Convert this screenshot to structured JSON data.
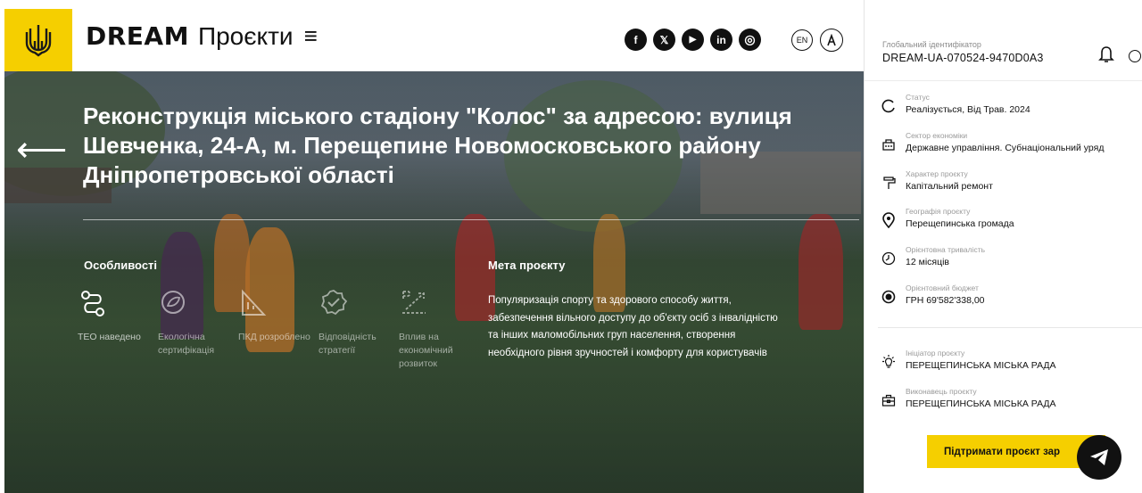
{
  "header": {
    "brand_bold": "DREAM",
    "brand_light": "Проєкти",
    "menu_glyph": "≡",
    "socials": [
      {
        "name": "facebook",
        "glyph": "f"
      },
      {
        "name": "x",
        "glyph": "𝕏"
      },
      {
        "name": "youtube",
        "glyph": "▶"
      },
      {
        "name": "linkedin",
        "glyph": "in"
      },
      {
        "name": "instagram",
        "glyph": "◎"
      }
    ],
    "lang": "EN"
  },
  "hero": {
    "back_glyph": "⟵",
    "title": "Реконструкція міського стадіону \"Колос\" за адресою: вулиця Шевченка, 24-А, м. Перещепине Новомосковського району Дніпропетровської області",
    "features_heading": "Особливості",
    "features": [
      {
        "icon": "route-icon",
        "label": "ТЕО наведено",
        "active": true
      },
      {
        "icon": "eco-certificate-icon",
        "label": "Екологічна сертифікація",
        "active": false
      },
      {
        "icon": "pkd-icon",
        "label": "ПКД розроблено",
        "active": false
      },
      {
        "icon": "strategy-check-icon",
        "label": "Відповідність стратегії",
        "active": false
      },
      {
        "icon": "economic-impact-icon",
        "label": "Вплив на економічний розвиток",
        "active": false
      }
    ],
    "goal_heading": "Мета проєкту",
    "goal_text": "Популяризація спорту та здорового способу життя, забезпечення вільного доступу до об'єкту осіб з інвалідністю та інших маломобільних груп населення, створення необхідного рівня зручностей і комфорту для користувачів"
  },
  "sidebar": {
    "global_id_label": "Глобальний ідентифікатор",
    "global_id": "DREAM-UA-070524-9470D0A3",
    "info": [
      {
        "icon": "status-icon",
        "caption": "Статус",
        "value": "Реалізується, Від Трав. 2024"
      },
      {
        "icon": "building-icon",
        "caption": "Сектор економіки",
        "value": "Державне управління. Субнаціональний уряд"
      },
      {
        "icon": "paint-roller-icon",
        "caption": "Характер проєкту",
        "value": "Капітальний ремонт"
      },
      {
        "icon": "location-pin-icon",
        "caption": "Географія проєкту",
        "value": "Перещепинська громада"
      },
      {
        "icon": "clock-icon",
        "caption": "Орієнтовна тривалість",
        "value": "12 місяців"
      },
      {
        "icon": "money-icon",
        "caption": "Орієнтовний бюджет",
        "value": "ГРН 69'582'338,00"
      },
      {
        "icon": "bulb-icon",
        "caption": "Ініціатор проєкту",
        "value": "ПЕРЕЩЕПИНСЬКА МІСЬКА РАДА"
      },
      {
        "icon": "briefcase-icon",
        "caption": "Виконавець проєкту",
        "value": "ПЕРЕЩЕПИНСЬКА МІСЬКА РАДА"
      }
    ],
    "support_label": "Підтримати проєкт зар"
  },
  "colors": {
    "accent": "#f5cf00",
    "text": "#111111"
  }
}
